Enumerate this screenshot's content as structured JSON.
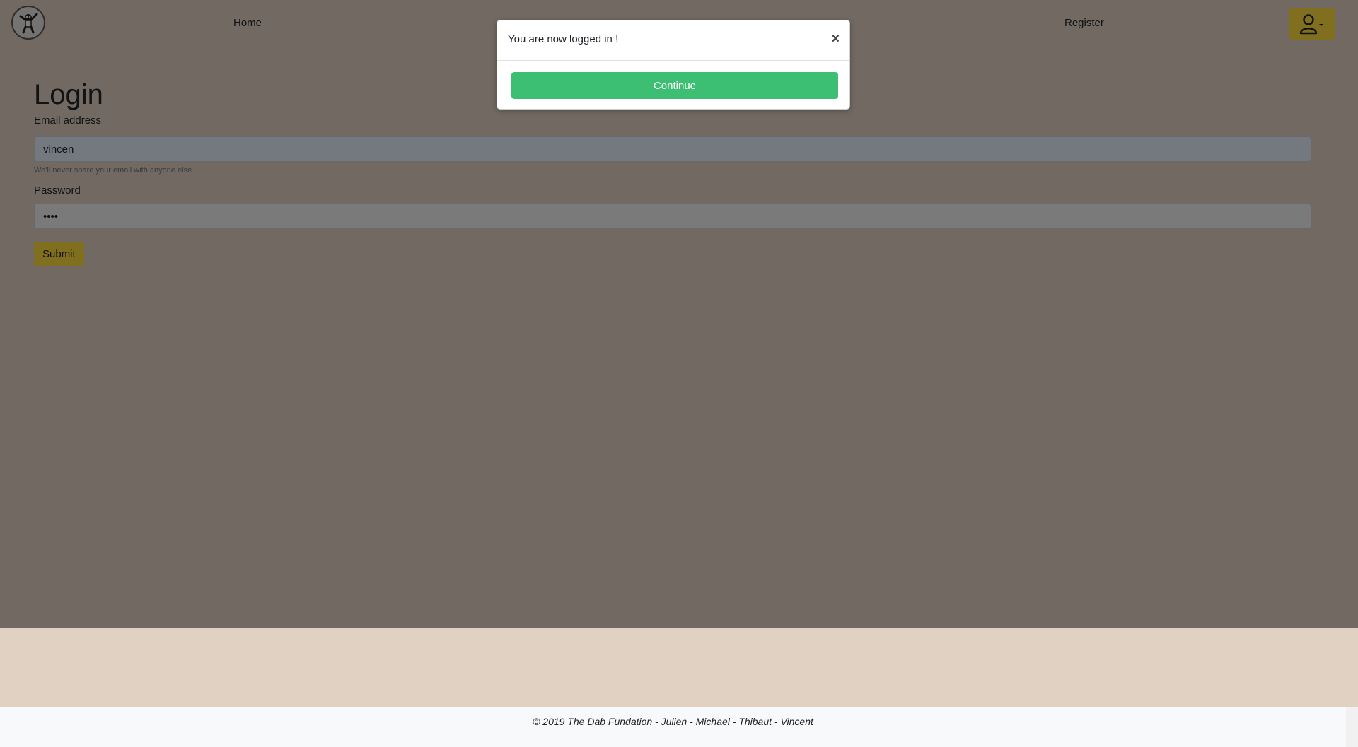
{
  "colors": {
    "accent_yellow": "#ffde3c",
    "continue_green": "#3cbf73",
    "main_background": "#e4d5c5",
    "footer_background": "#f8f9fa"
  },
  "navbar": {
    "logo_icon": "dab-panda-logo",
    "links": {
      "home": "Home",
      "register": "Register"
    },
    "user_menu_icon": "user-icon"
  },
  "form": {
    "title": "Login",
    "email": {
      "label": "Email address",
      "value": "vincen",
      "help": "We'll never share your email with anyone else."
    },
    "password": {
      "label": "Password",
      "value": "••••"
    },
    "submit_label": "Submit"
  },
  "modal": {
    "message": "You are now logged in !",
    "close_symbol": "×",
    "continue_label": "Continue"
  },
  "footer": {
    "text": "© 2019 The Dab Fundation - Julien - Michael - Thibaut - Vincent"
  }
}
